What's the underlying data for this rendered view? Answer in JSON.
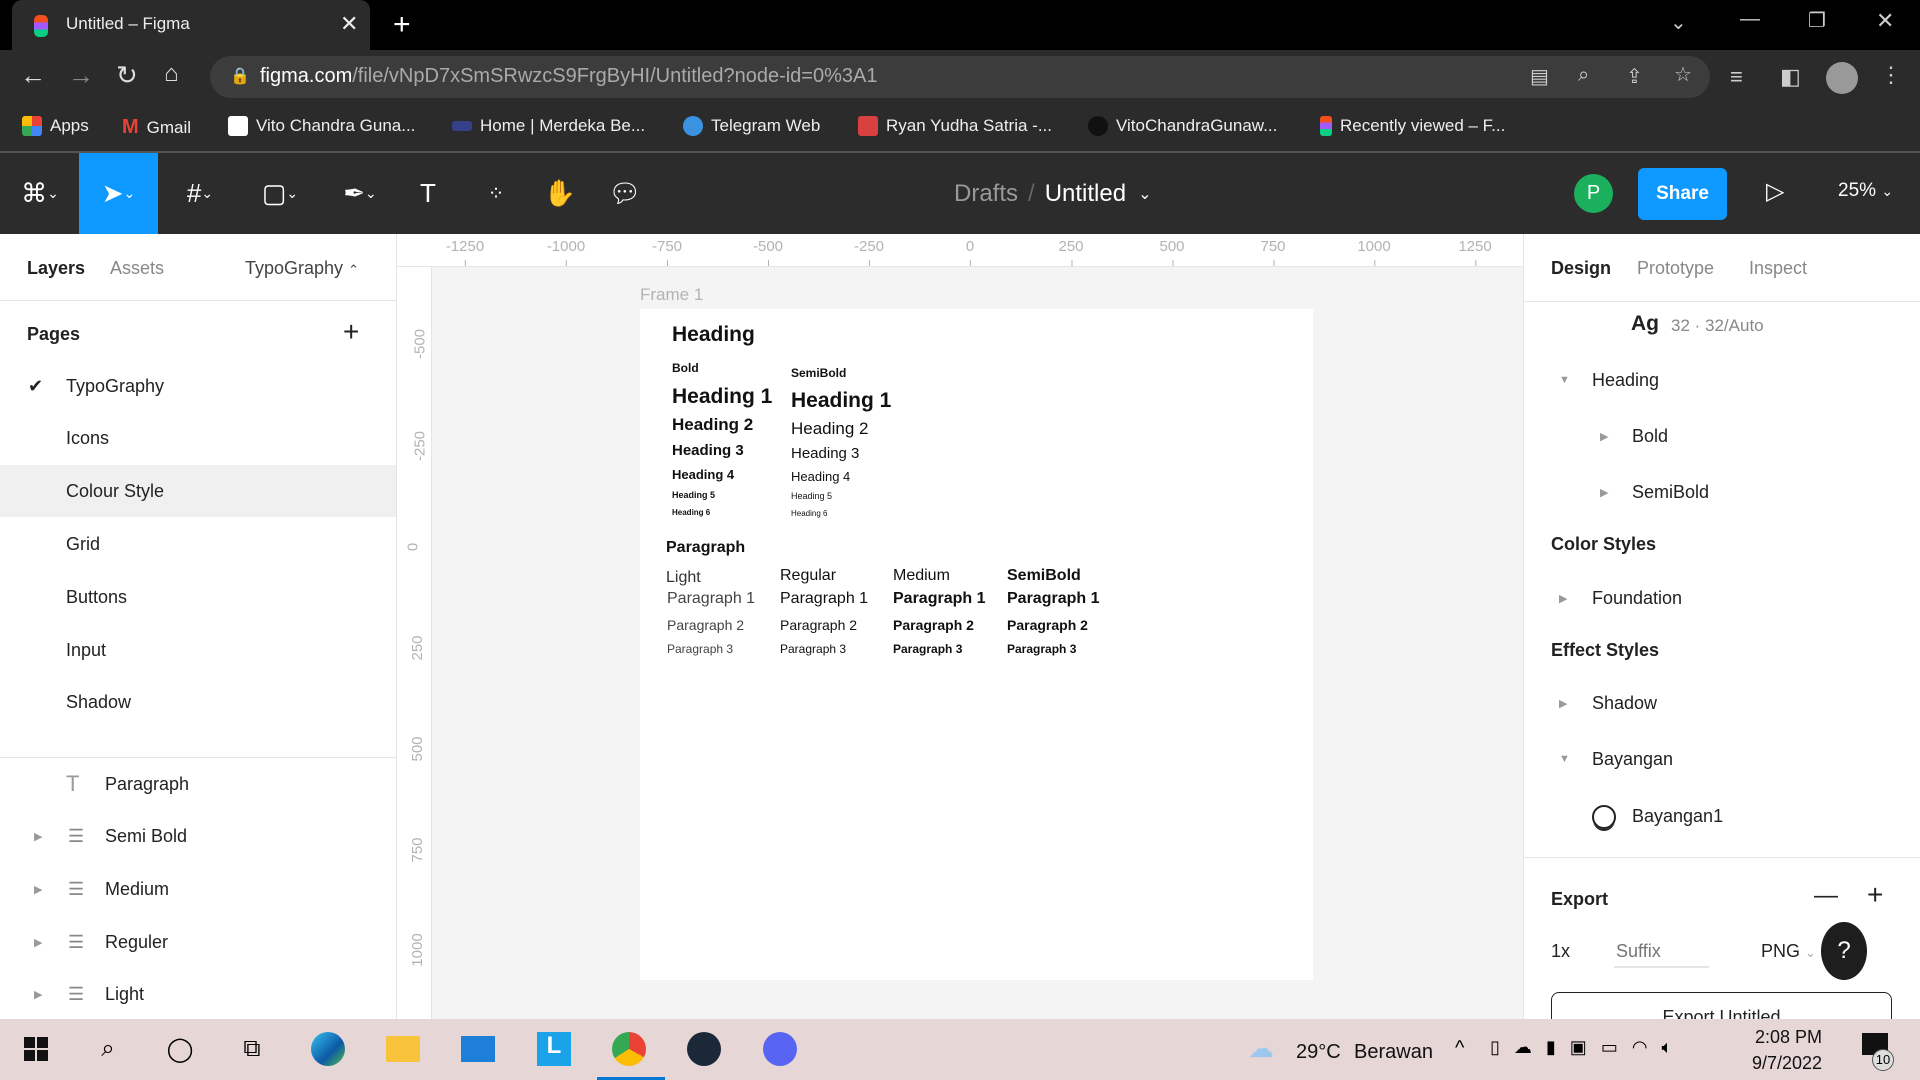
{
  "browser": {
    "tab_title": "Untitled – Figma",
    "url_host": "figma.com",
    "url_path": "/file/vNpD7xSmSRwzcS9FrgByHI/Untitled?node-id=0%3A1",
    "bookmarks": [
      "Apps",
      "Gmail",
      "Vito Chandra Guna...",
      "Home | Merdeka Be...",
      "Telegram Web",
      "Ryan Yudha Satria -...",
      "VitoChandraGunaw...",
      "Recently viewed – F..."
    ]
  },
  "toolbar": {
    "breadcrumb_parent": "Drafts",
    "file_name": "Untitled",
    "avatar_initial": "P",
    "share_label": "Share",
    "zoom": "25%"
  },
  "left_panel": {
    "tabs": [
      "Layers",
      "Assets"
    ],
    "page_selector": "TypoGraphy",
    "pages_title": "Pages",
    "pages": [
      "TypoGraphy",
      "Icons",
      "Colour Style",
      "Grid",
      "Buttons",
      "Input",
      "Shadow"
    ],
    "layers": [
      "Paragraph",
      "Semi Bold",
      "Medium",
      "Reguler",
      "Light"
    ]
  },
  "ruler": {
    "x": [
      "-1250",
      "-1000",
      "-750",
      "-500",
      "-250",
      "0",
      "250",
      "500",
      "750",
      "1000",
      "1250"
    ],
    "y": [
      "-500",
      "-250",
      "0",
      "250",
      "500",
      "750",
      "1000"
    ]
  },
  "canvas": {
    "frame_label": "Frame 1",
    "heading_title": "Heading",
    "bold_label": "Bold",
    "semibold_label": "SemiBold",
    "headings": [
      "Heading 1",
      "Heading 2",
      "Heading 3",
      "Heading 4",
      "Heading 5",
      "Heading 6"
    ],
    "paragraph_title": "Paragraph",
    "paragraph_weights": [
      "Light",
      "Regular",
      "Medium",
      "SemiBold"
    ],
    "paragraphs": [
      "Paragraph 1",
      "Paragraph 2",
      "Paragraph 3"
    ]
  },
  "right_panel": {
    "tabs": [
      "Design",
      "Prototype",
      "Inspect"
    ],
    "text_preview": "Ag",
    "text_meta": "32 · 32/Auto",
    "heading_group": "Heading",
    "heading_children": [
      "Bold",
      "SemiBold"
    ],
    "color_styles_title": "Color Styles",
    "color_styles": [
      "Foundation"
    ],
    "effect_styles_title": "Effect Styles",
    "effect_styles": [
      "Shadow",
      "Bayangan"
    ],
    "effect_child": "Bayangan1",
    "export_title": "Export",
    "export_scale": "1x",
    "export_suffix_placeholder": "Suffix",
    "export_format": "PNG",
    "export_button": "Export Untitled",
    "help": "?"
  },
  "taskbar": {
    "temperature": "29°C",
    "weather": "Berawan",
    "time": "2:08 PM",
    "date": "9/7/2022",
    "notifications": "10"
  },
  "colors": {
    "accent": "#0d99ff",
    "avatar": "#1bb05c"
  }
}
